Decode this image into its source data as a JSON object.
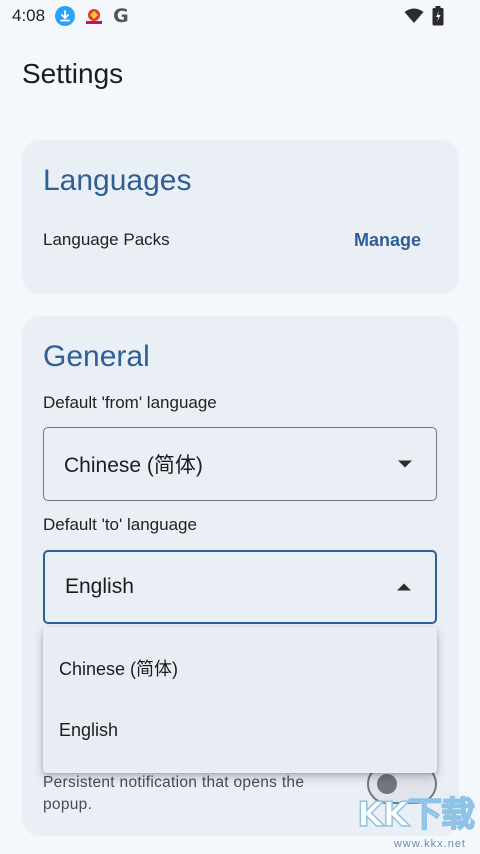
{
  "status_bar": {
    "time": "4:08",
    "icons": [
      "download-icon",
      "app-icon",
      "google-icon",
      "wifi-icon",
      "battery-icon"
    ],
    "google_glyph": "G"
  },
  "page_title": "Settings",
  "languages_section": {
    "title": "Languages",
    "language_packs_label": "Language Packs",
    "manage_label": "Manage"
  },
  "general_section": {
    "title": "General",
    "from_label": "Default 'from' language",
    "from_value": "Chinese (简体)",
    "to_label": "Default 'to' language",
    "to_value": "English",
    "notification_description": "Persistent notification that opens the popup."
  },
  "dropdown": {
    "options": [
      "Chinese (简体)",
      "English"
    ]
  },
  "watermark": {
    "big": "KK下载",
    "small": "www.kkx.net"
  },
  "colors": {
    "accent": "#2f5f95",
    "background": "#f4f7fc",
    "card": "#eaeef5"
  }
}
